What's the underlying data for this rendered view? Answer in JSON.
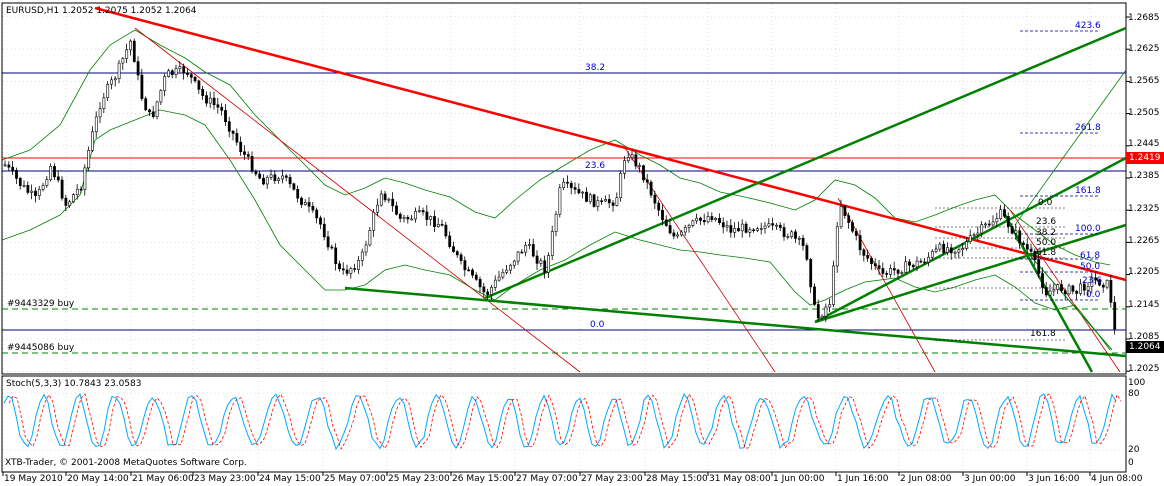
{
  "chart": {
    "symbol_header": "EURUSD,H1  1.2052 1.2075 1.2052 1.2064",
    "price_axis": [
      "1.2685",
      "1.2625",
      "1.2565",
      "1.2505",
      "1.2445",
      "1.2385",
      "1.2325",
      "1.2265",
      "1.2205",
      "1.2145",
      "1.2085",
      "1.2025"
    ],
    "current_price_tag": "1.2064",
    "red_level_tag": "1.2419",
    "fib_labels": {
      "f382_top": "38.2",
      "f236": "23.6",
      "f0": "0.0",
      "f4236": "423.6",
      "f2618": "261.8",
      "f1618_upper": "161.8",
      "f1000": "100.0",
      "f618": "61.8",
      "f500": "50.0",
      "f1618_lower": "161.8",
      "r00_a": "0.0",
      "r236": "23.6",
      "r382": "38.2",
      "r500": "50.0",
      "r618": "61.8",
      "b382": "38.2",
      "b500": "50.0",
      "b236": "23.6",
      "b00": "0.0"
    },
    "order_labels": [
      "#9443329 buy",
      "#9445086 buy"
    ],
    "time_axis": [
      "19 May 2010",
      "20 May 14:00",
      "21 May 06:00",
      "23 May 23:00",
      "24 May 15:00",
      "25 May 07:00",
      "25 May 23:00",
      "26 May 15:00",
      "27 May 07:00",
      "27 May 23:00",
      "28 May 15:00",
      "31 May 08:00",
      "1 Jun 00:00",
      "1 Jun 16:00",
      "2 Jun 08:00",
      "3 Jun 00:00",
      "3 Jun 16:00",
      "4 Jun 08:00"
    ]
  },
  "stochastic": {
    "header": "Stoch(5,3,3) 10.7843 23.0583",
    "levels": [
      "100",
      "80",
      "20",
      "0"
    ],
    "copyright": "XTB-Trader, © 2001-2008 MetaQuotes Software Corp."
  },
  "colors": {
    "candle": "#000000",
    "bollinger": "#008000",
    "trendline_red": "#ff0000",
    "trendline_green": "#008000",
    "hline_blue": "#000080",
    "stoch_main": "#00aaff",
    "stoch_signal": "#ff0000"
  }
}
